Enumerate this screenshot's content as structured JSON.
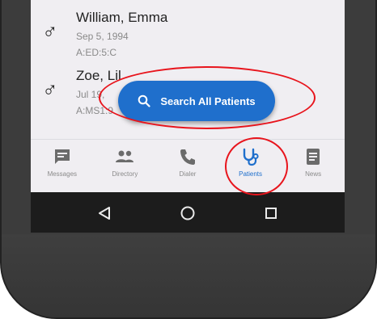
{
  "patients": [
    {
      "gender_icon": "male-icon",
      "gender_symbol": "♂",
      "name": "William, Emma",
      "dob": "Sep 5, 1994",
      "code": "A:ED:5:C"
    },
    {
      "gender_icon": "male-icon",
      "gender_symbol": "♂",
      "name": "Zoe, Lil",
      "dob": "Jul 19,",
      "code": "A:MS1:9"
    }
  ],
  "search_button": {
    "label": "Search All Patients",
    "icon": "search-icon"
  },
  "bottom_nav": {
    "items": [
      {
        "label": "Messages",
        "icon": "message-icon",
        "active": false
      },
      {
        "label": "Directory",
        "icon": "people-icon",
        "active": false
      },
      {
        "label": "Dialer",
        "icon": "phone-icon",
        "active": false
      },
      {
        "label": "Patients",
        "icon": "stethoscope-icon",
        "active": true
      },
      {
        "label": "News",
        "icon": "news-icon",
        "active": false
      }
    ]
  },
  "system_nav": {
    "back_icon": "back-triangle-icon",
    "home_icon": "home-circle-icon",
    "recents_icon": "recents-square-icon"
  },
  "colors": {
    "accent": "#1f6fcc",
    "annotation": "#e8141c",
    "icon_gray": "#6b6b6b"
  }
}
